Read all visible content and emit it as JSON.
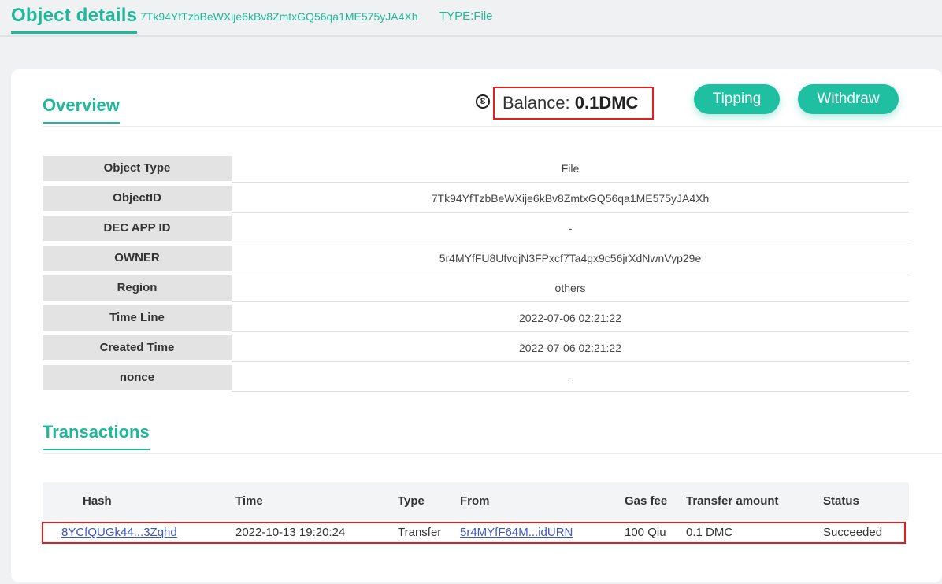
{
  "header": {
    "title": "Object details",
    "object_id": "7Tk94YfTzbBeWXije6kBv8ZmtxGQ56qa1ME575yJA4Xh",
    "object_type": "TYPE:File"
  },
  "overview": {
    "title": "Overview",
    "balance_icon": "Ɛ",
    "balance_label": "Balance:",
    "balance_value": "0.1DMC",
    "tipping_label": "Tipping",
    "withdraw_label": "Withdraw"
  },
  "details": [
    {
      "label": "Object Type",
      "value": "File"
    },
    {
      "label": "ObjectID",
      "value": "7Tk94YfTzbBeWXije6kBv8ZmtxGQ56qa1ME575yJA4Xh"
    },
    {
      "label": "DEC APP ID",
      "value": "-"
    },
    {
      "label": "OWNER",
      "value": "5r4MYfFU8UfvqjN3FPxcf7Ta4gx9c56jrXdNwnVyp29e"
    },
    {
      "label": "Region",
      "value": "others"
    },
    {
      "label": "Time Line",
      "value": "2022-07-06 02:21:22"
    },
    {
      "label": "Created Time",
      "value": "2022-07-06 02:21:22"
    },
    {
      "label": "nonce",
      "value": "-"
    }
  ],
  "transactions": {
    "title": "Transactions",
    "columns": [
      "Hash",
      "Time",
      "Type",
      "From",
      "Gas fee",
      "Transfer amount",
      "Status"
    ],
    "rows": [
      {
        "hash": "8YCfQUGk44...3Zqhd",
        "time": "2022-10-13 19:20:24",
        "type": "Transfer",
        "from": "5r4MYfF64M...idURN",
        "gas_fee": "100 Qiu",
        "amount": "0.1 DMC",
        "status": "Succeeded"
      }
    ]
  },
  "colors": {
    "accent": "#1fb89a",
    "highlight": "#e02020",
    "link": "#3b55c8"
  }
}
